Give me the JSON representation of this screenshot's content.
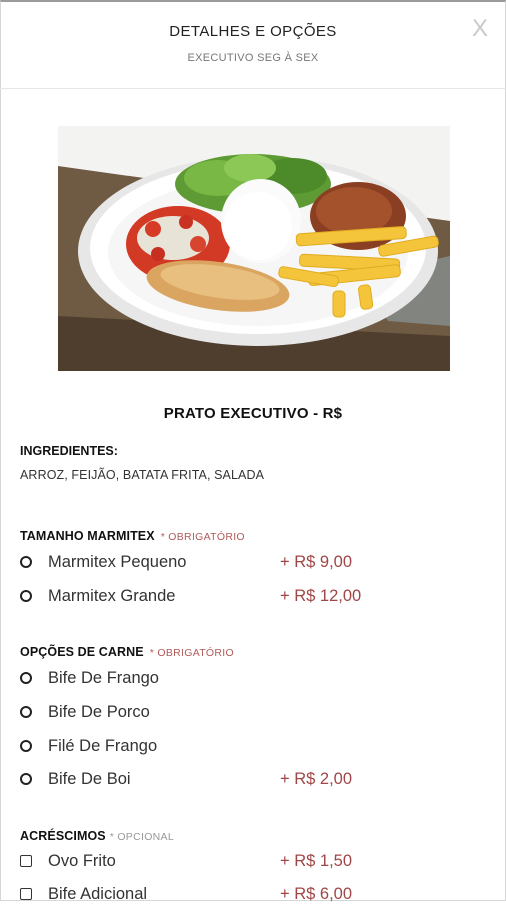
{
  "header": {
    "title": "DETALHES E OPÇÕES",
    "subtitle": "EXECUTIVO SEG À SEX",
    "close_label": "X"
  },
  "dish": {
    "name": "PRATO EXECUTIVO - R$",
    "ingredients_label": "INGREDIENTES:",
    "ingredients": "ARROZ, FEIJÃO, BATATA FRITA, SALADA"
  },
  "sections": {
    "size": {
      "title": "TAMANHO MARMITEX",
      "tag": "* OBRIGATÓRIO",
      "options": [
        {
          "label": "Marmitex Pequeno",
          "price": "+ R$ 9,00"
        },
        {
          "label": "Marmitex Grande",
          "price": "+ R$ 12,00"
        }
      ]
    },
    "meat": {
      "title": "OPÇÕES DE CARNE",
      "tag": "* OBRIGATÓRIO",
      "options": [
        {
          "label": "Bife De Frango",
          "price": ""
        },
        {
          "label": "Bife De Porco",
          "price": ""
        },
        {
          "label": "Filé De Frango",
          "price": ""
        },
        {
          "label": "Bife De Boi",
          "price": "+ R$ 2,00"
        }
      ]
    },
    "extras": {
      "title": "ACRÉSCIMOS",
      "tag": "* OPCIONAL",
      "options": [
        {
          "label": "Ovo Frito",
          "price": "+ R$ 1,50"
        },
        {
          "label": "Bife Adicional",
          "price": "+ R$ 6,00"
        }
      ]
    }
  },
  "colors": {
    "price": "#a14646",
    "required_tag": "#b05a5a"
  }
}
